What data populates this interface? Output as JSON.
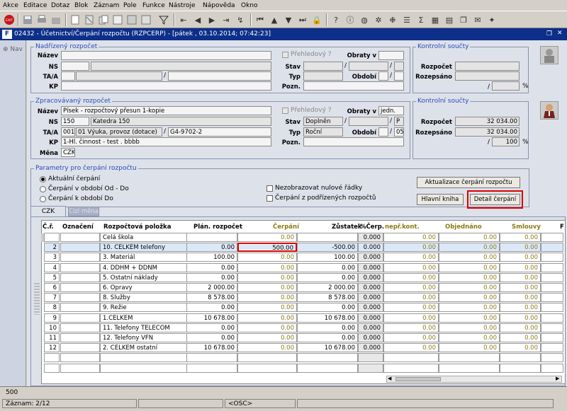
{
  "menu": [
    "Akce",
    "Editace",
    "Dotaz",
    "Blok",
    "Záznam",
    "Pole",
    "Funkce",
    "Nástroje",
    "Nápověda",
    "Okno"
  ],
  "toolbar_icons": [
    "exit-icon",
    "save-icon",
    "print-icon",
    "open-icon",
    "new-record-icon",
    "delete-record-icon",
    "filter-icon",
    "prev-block-icon",
    "prev-record-icon",
    "next-record-icon",
    "next-block-icon",
    "execute-query-icon",
    "lock-icon",
    "help-icon",
    "globe-icon",
    "list-icon",
    "settings-icon",
    "sigma-icon",
    "grid-icon",
    "chart-icon",
    "mail-icon",
    "extension-icon"
  ],
  "window": {
    "title": "02432 - Účetnictví/Čerpání rozpočtu (RZPCERP) - [pátek  , 03.10.2014; 07:42:23]"
  },
  "nav": {
    "label": "Nav"
  },
  "nadrizeny": {
    "legend": "Nadřízený rozpočet",
    "labels": {
      "nazev": "Název",
      "ns": "NS",
      "taa": "TA/A",
      "kp": "KP",
      "stav": "Stav",
      "typ": "Typ",
      "pozn": "Pozn.",
      "obraty": "Obraty v",
      "obdobi": "Období"
    },
    "prehledovy": "Přehledový ?",
    "kontrolni": {
      "legend": "Kontrolní součty",
      "rozpocet": "Rozpočet",
      "rozepsano": "Rozepsáno",
      "pct": "%"
    }
  },
  "zpracovavany": {
    "legend": "Zpracovávaný rozpočet",
    "labels": {
      "nazev": "Název",
      "ns": "NS",
      "taa": "TA/A",
      "kp": "KP",
      "mena": "Měna",
      "stav": "Stav",
      "typ": "Typ",
      "pozn": "Pozn.",
      "obraty": "Obraty v",
      "obdobi": "Období"
    },
    "values": {
      "nazev": "Písek - rozpočtový přesun 1-kopie",
      "ns_code": "150",
      "ns_name": "Katedra 150",
      "ta": "001",
      "ta_name": "01 Výuka, provoz (dotace)",
      "a": "G4-9702-2",
      "kp": "1-Hl. činnost - test . bbbb",
      "mena": "CZK",
      "stav": "Doplněn",
      "stav2": "P",
      "typ": "Roční",
      "obdobi2": "05",
      "obraty": "jedn."
    },
    "prehledovy": "Přehledový ?",
    "kontrolni": {
      "legend": "Kontrolní součty",
      "rozpocet": "Rozpočet",
      "rozepsano": "Rozepsáno",
      "rozpocet_val": "32 034.00",
      "rozepsano_val": "32 034.00",
      "pct_val": "100",
      "pct": "%"
    }
  },
  "params": {
    "legend": "Parametry pro čerpání rozpočtu",
    "radios": [
      "Aktuální čerpání",
      "Čerpání v období Od - Do",
      "Čerpání k období Do"
    ],
    "cb1": "Nezobrazovat nulové řádky",
    "cb2": "Čerpání z podřízených rozpočtů",
    "btn_aktualizace": "Aktualizace čerpání rozpočtu",
    "btn_hlavni": "Hlavní kniha",
    "btn_detail": "Detail čerpání"
  },
  "tabs": [
    "CZK",
    "Cizí měna"
  ],
  "table": {
    "headers": {
      "cr": "Č.ř.",
      "oznaceni": "Označení",
      "polozka": "Rozpočtová položka",
      "plan": "Plán. rozpočet",
      "cerpani": "Čerpání",
      "zustatek": "Zůstatek",
      "pct": "%Čerp.",
      "nepr": "nepř.kont.",
      "objednano": "Objednáno",
      "smlouvy": "Smlouvy",
      "more": "F"
    },
    "rows": [
      {
        "cr": "",
        "polozka": "Celá škola",
        "plan": "",
        "cerpani": "0.00",
        "zustatek": "",
        "pct": "0.000",
        "nepr": "0.00",
        "obj": "0.00",
        "sml": "0.00"
      },
      {
        "cr": "2",
        "polozka": "10.  CELKEM telefony",
        "plan": "0.00",
        "cerpani": "500.00",
        "zustatek": "-500.00",
        "pct": "0.000",
        "nepr": "0.00",
        "obj": "0.00",
        "sml": "0.00"
      },
      {
        "cr": "3",
        "polozka": "3.    Materiál",
        "plan": "100.00",
        "cerpani": "0.00",
        "zustatek": "100.00",
        "pct": "0.000",
        "nepr": "0.00",
        "obj": "0.00",
        "sml": "0.00"
      },
      {
        "cr": "4",
        "polozka": "4.    DDHM + DDNM",
        "plan": "0.00",
        "cerpani": "0.00",
        "zustatek": "0.00",
        "pct": "0.000",
        "nepr": "0.00",
        "obj": "0.00",
        "sml": "0.00"
      },
      {
        "cr": "5",
        "polozka": "5.    Ostatní náklady",
        "plan": "0.00",
        "cerpani": "0.00",
        "zustatek": "0.00",
        "pct": "0.000",
        "nepr": "0.00",
        "obj": "0.00",
        "sml": "0.00"
      },
      {
        "cr": "6",
        "polozka": "6.    Opravy",
        "plan": "2 000.00",
        "cerpani": "0.00",
        "zustatek": "2 000.00",
        "pct": "0.000",
        "nepr": "0.00",
        "obj": "0.00",
        "sml": "0.00"
      },
      {
        "cr": "7",
        "polozka": "8.    Služby",
        "plan": "8 578.00",
        "cerpani": "0.00",
        "zustatek": "8 578.00",
        "pct": "0.000",
        "nepr": "0.00",
        "obj": "0.00",
        "sml": "0.00"
      },
      {
        "cr": "8",
        "polozka": "9.    Režie",
        "plan": "0.00",
        "cerpani": "0.00",
        "zustatek": "0.00",
        "pct": "0.000",
        "nepr": "0.00",
        "obj": "0.00",
        "sml": "0.00"
      },
      {
        "cr": "9",
        "polozka": "1.CELKEM",
        "plan": "10 678.00",
        "cerpani": "0.00",
        "zustatek": "10 678.00",
        "pct": "0.000",
        "nepr": "0.00",
        "obj": "0.00",
        "sml": "0.00"
      },
      {
        "cr": "10",
        "polozka": "11.   Telefony TELECOM",
        "plan": "0.00",
        "cerpani": "0.00",
        "zustatek": "0.00",
        "pct": "0.000",
        "nepr": "0.00",
        "obj": "0.00",
        "sml": "0.00"
      },
      {
        "cr": "11",
        "polozka": "12.   Telefony VFN",
        "plan": "0.00",
        "cerpani": "0.00",
        "zustatek": "0.00",
        "pct": "0.000",
        "nepr": "0.00",
        "obj": "0.00",
        "sml": "0.00"
      },
      {
        "cr": "12",
        "polozka": "2.  CELKEM ostatní",
        "plan": "10 678.00",
        "cerpani": "0.00",
        "zustatek": "10 678.00",
        "pct": "0.000",
        "nepr": "0.00",
        "obj": "0.00",
        "sml": "0.00"
      },
      {
        "cr": "",
        "polozka": "",
        "plan": "",
        "cerpani": "",
        "zustatek": "",
        "pct": "",
        "nepr": "",
        "obj": "",
        "sml": ""
      },
      {
        "cr": "",
        "polozka": "",
        "plan": "",
        "cerpani": "",
        "zustatek": "",
        "pct": "",
        "nepr": "",
        "obj": "",
        "sml": ""
      }
    ]
  },
  "status": {
    "message": "500",
    "zaznam": "Záznam: 2/12",
    "osc": "<OSC>"
  }
}
